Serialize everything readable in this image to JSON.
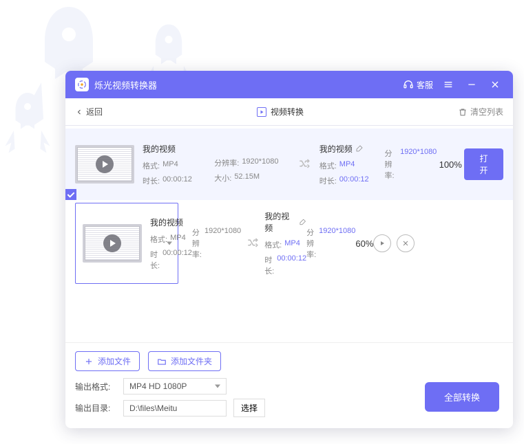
{
  "app": {
    "title": "烁光视频转换器"
  },
  "titlebar": {
    "support": "客服"
  },
  "tabbar": {
    "back": "返回",
    "active": "视频转换",
    "clear": "清空列表"
  },
  "labels": {
    "format": "格式:",
    "resolution": "分辨率:",
    "duration": "时长:",
    "size": "大小:"
  },
  "items": [
    {
      "title": "我的视频",
      "format": "MP4",
      "resolution": "1920*1080",
      "duration": "00:00:12",
      "size": "52.15M",
      "outTitle": "我的视频",
      "outFormat": "MP4",
      "outDuration": "00:00:12",
      "outResolution": "1920*1080",
      "progress": "100%",
      "done": true,
      "selected": false,
      "openLabel": "打开"
    },
    {
      "title": "我的视频",
      "format": "MP4",
      "resolution": "1920*1080",
      "duration": "00:00:12",
      "size": "",
      "outTitle": "我的视频",
      "outFormat": "MP4",
      "outDuration": "00:00:12",
      "outResolution": "1920*1080",
      "progress": "60%",
      "done": false,
      "selected": true,
      "openLabel": ""
    }
  ],
  "footer": {
    "addFile": "添加文件",
    "addFolder": "添加文件夹",
    "outFormatLabel": "输出格式:",
    "outFormatValue": "MP4 HD 1080P",
    "outDirLabel": "输出目录:",
    "outDirValue": "D:\\files\\Meitu",
    "browse": "选择",
    "convertAll": "全部转换"
  },
  "colors": {
    "primary": "#6e6ef4"
  }
}
